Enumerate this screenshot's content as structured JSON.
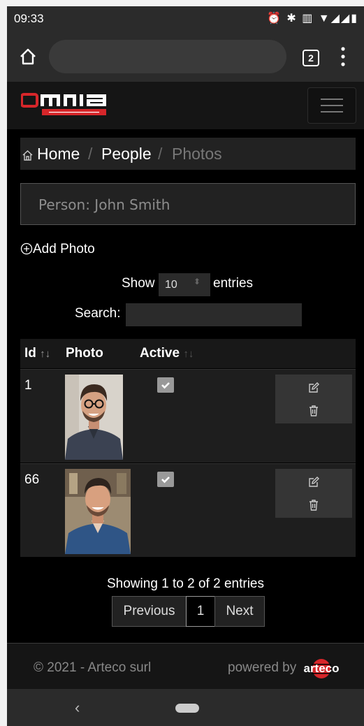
{
  "status_bar": {
    "time": "09:33",
    "icons": "⏰ ✱ ▥ ▼◢◢▮"
  },
  "browser": {
    "tab_count": "2"
  },
  "breadcrumb": {
    "home": "Home",
    "sep1": "/",
    "people": "People",
    "sep2": "/",
    "photos": "Photos"
  },
  "person": {
    "text": "Person: John Smith"
  },
  "add_photo": {
    "label": "Add Photo"
  },
  "length": {
    "show": "Show",
    "value": "10",
    "entries": "entries"
  },
  "search": {
    "label": "Search:",
    "value": ""
  },
  "table": {
    "headers": {
      "id": "Id",
      "photo": "Photo",
      "active": "Active"
    },
    "rows": [
      {
        "id": "1",
        "active": true
      },
      {
        "id": "66",
        "active": true
      }
    ]
  },
  "pagination": {
    "info": "Showing 1 to 2 of 2 entries",
    "previous": "Previous",
    "current": "1",
    "next": "Next"
  },
  "footer": {
    "copyright": "© 2021 - Arteco surl",
    "powered": "powered by"
  },
  "colors": {
    "accent_red": "#d6262a",
    "background": "#000000",
    "panel": "#222222"
  }
}
